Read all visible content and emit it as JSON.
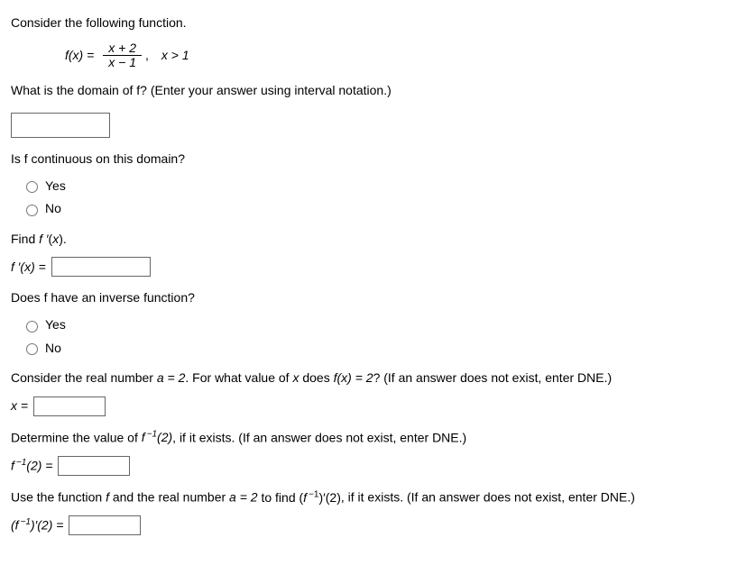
{
  "q1": "Consider the following function.",
  "formula": {
    "lhs": "f(x) =",
    "numerator": "x + 2",
    "denominator": "x − 1",
    "comma": ",",
    "condition": "x > 1"
  },
  "q2": "What is the domain of f? (Enter your answer using interval notation.)",
  "q3": "Is f continuous on this domain?",
  "options": {
    "yes": "Yes",
    "no": "No"
  },
  "q4": "Find f ′(x).",
  "fprime_label": "f ′(x) =",
  "q5": "Does f have an inverse function?",
  "q6_prefix": "Consider the real number ",
  "q6_a_eq": "a = 2",
  "q6_mid": ". For what value of ",
  "q6_x": "x",
  "q6_does": " does ",
  "q6_fx": "f(x) = 2",
  "q6_suffix": "? (If an answer does not exist, enter DNE.)",
  "x_label": "x =",
  "q7_prefix": "Determine the value of ",
  "q7_finv": "f −1(2)",
  "q7_suffix": ", if it exists. (If an answer does not exist, enter DNE.)",
  "finv_label_1": "f",
  "finv_label_exp": "−1",
  "finv_label_2": "(2) =",
  "q8_prefix": "Use the function ",
  "q8_f": "f",
  "q8_mid1": " and the real number ",
  "q8_a": "a = 2",
  "q8_mid2": " to find (",
  "q8_finvp": "f −1)′(2)",
  "q8_suffix": ", if it exists. (If an answer does not exist, enter DNE.)",
  "finvp_label_1": "(f",
  "finvp_label_2": ")′(2) ="
}
